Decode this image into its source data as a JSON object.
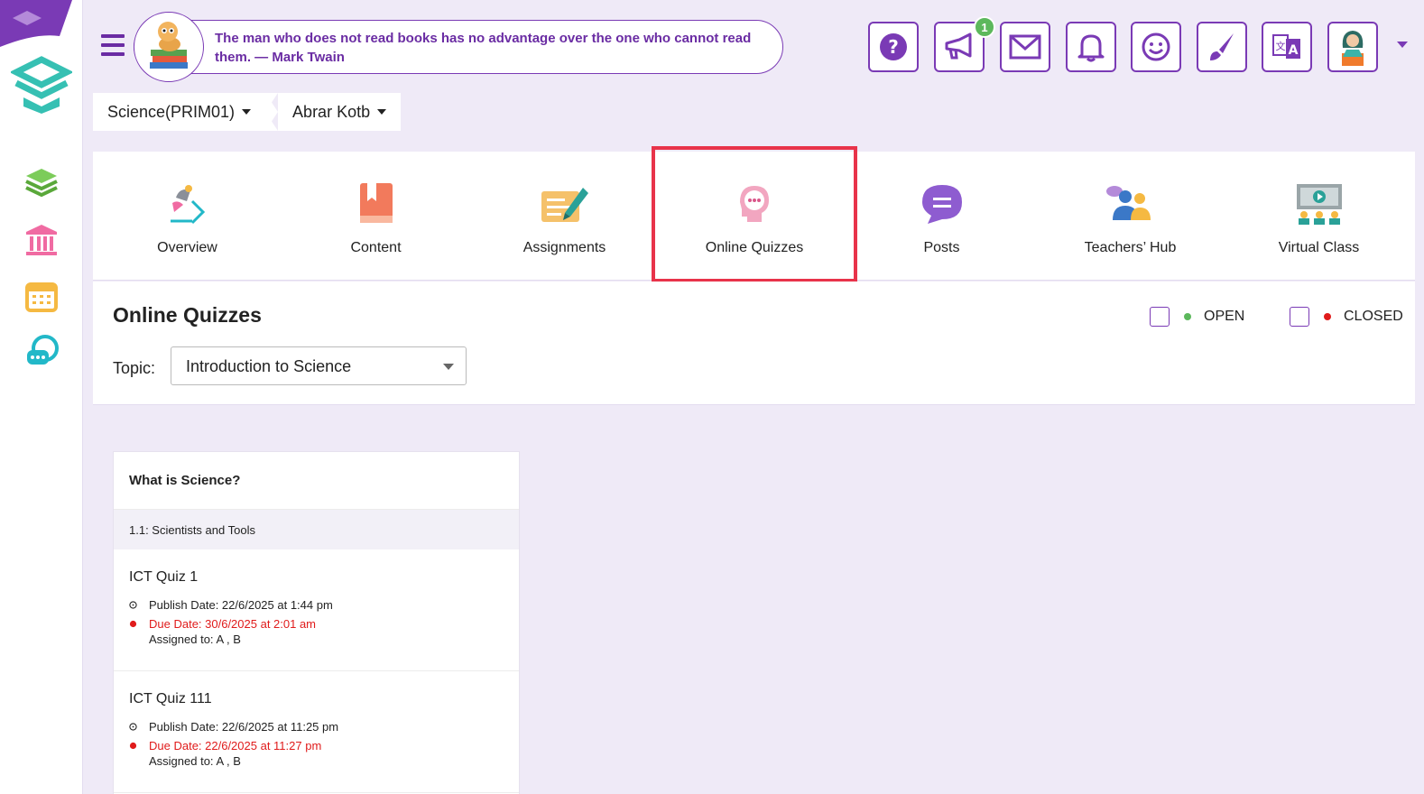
{
  "header": {
    "quote": "The man who does not read books has no advantage over the one who cannot read them. — Mark Twain",
    "notification_badge": "1",
    "toolbar_icons": [
      "help-icon",
      "megaphone-icon",
      "mail-icon",
      "bell-icon",
      "smiley-icon",
      "paintbrush-icon",
      "translate-icon",
      "user-avatar-icon"
    ]
  },
  "breadcrumb": {
    "course": "Science(PRIM01)",
    "user": "Abrar Kotb"
  },
  "tabs": [
    {
      "label": "Overview",
      "icon": "overview-icon"
    },
    {
      "label": "Content",
      "icon": "book-icon"
    },
    {
      "label": "Assignments",
      "icon": "assignment-icon"
    },
    {
      "label": "Online Quizzes",
      "icon": "quiz-head-icon",
      "highlighted": true
    },
    {
      "label": "Posts",
      "icon": "chat-bubble-icon"
    },
    {
      "label": "Teachers’ Hub",
      "icon": "teachers-hub-icon"
    },
    {
      "label": "Virtual Class",
      "icon": "virtual-class-icon"
    }
  ],
  "quizzes": {
    "title": "Online Quizzes",
    "topic_label": "Topic:",
    "topic_value": "Introduction to Science",
    "legend": {
      "open_label": "OPEN",
      "closed_label": "CLOSED"
    }
  },
  "card": {
    "title": "What is Science?",
    "subtitle": "1.1: Scientists and Tools",
    "items": [
      {
        "title": "ICT Quiz 1",
        "publish": "Publish Date: 22/6/2025 at 1:44 pm",
        "due": "Due Date: 30/6/2025 at 2:01 am",
        "assigned": "Assigned to: A , B"
      },
      {
        "title": "ICT Quiz 111",
        "publish": "Publish Date: 22/6/2025 at 11:25 pm",
        "due": "Due Date: 22/6/2025 at 11:27 pm",
        "assigned": "Assigned to: A , B"
      }
    ]
  },
  "colors": {
    "brand_purple": "#7a3ab5",
    "highlight_red": "#e8334a",
    "open_green": "#5cb85c",
    "closed_red": "#e01b1b",
    "background": "#efeaf7"
  }
}
